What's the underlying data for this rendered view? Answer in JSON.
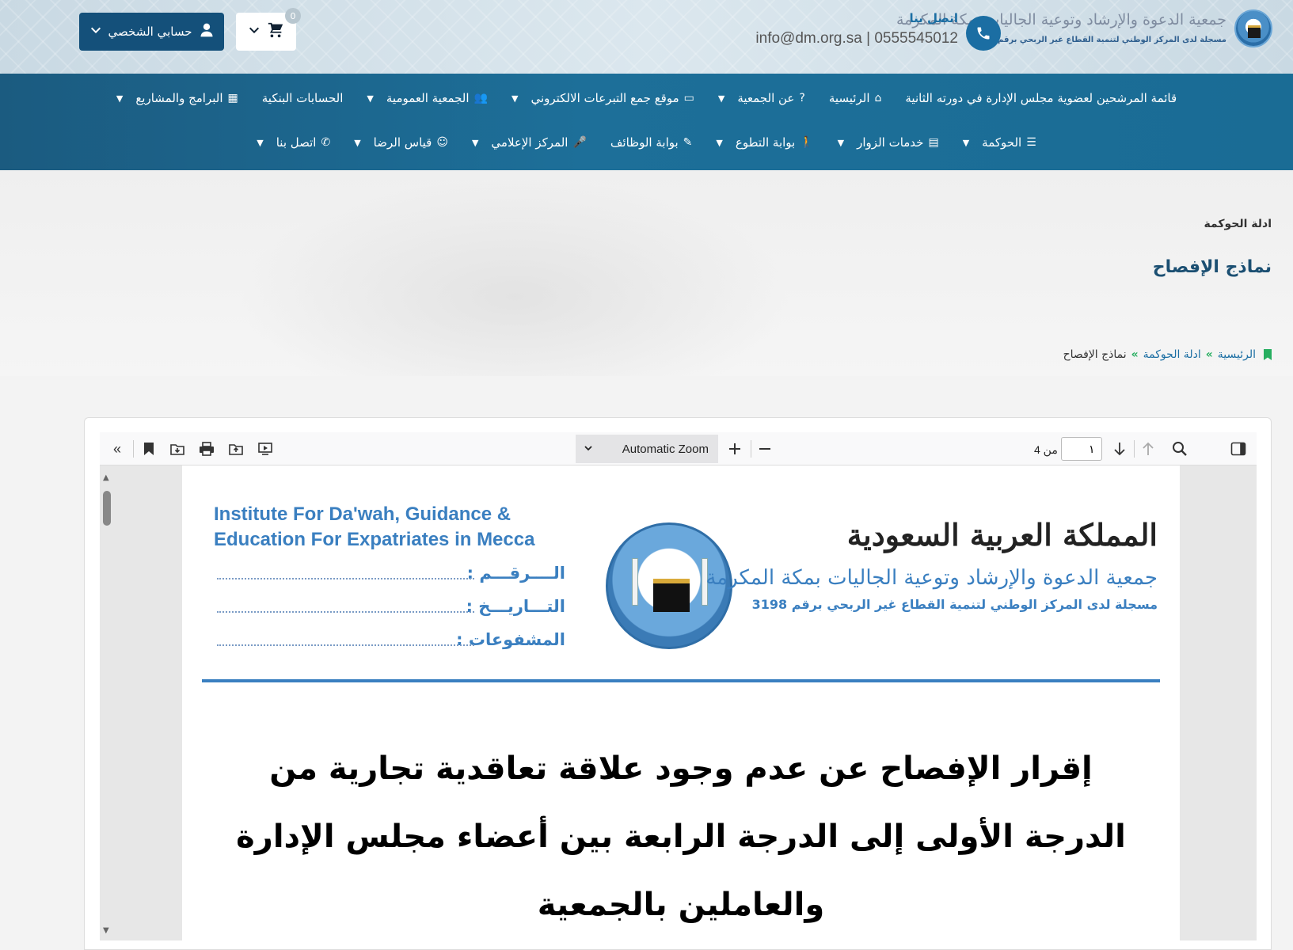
{
  "header": {
    "logo_title": "جمعية الدعوة والإرشاد وتوعية الجاليات بمكة المكرمة",
    "logo_subtitle": "مسجلة لدى المركز الوطني لتنمية القطاع غير الربحي برقم 3198",
    "contact_label": "اتصل بنا",
    "contact_line": "info@dm.org.sa | 0555545012",
    "cart_count": "0",
    "account_label": "حسابي الشخصي"
  },
  "nav": {
    "row1": [
      {
        "label": "قائمة المرشحين لعضوية مجلس الإدارة في دورته الثانية",
        "icon": "",
        "dropdown": false
      },
      {
        "label": "الرئيسية",
        "icon": "home-icon",
        "dropdown": false
      },
      {
        "label": "عن الجمعية",
        "icon": "question-icon",
        "dropdown": true
      },
      {
        "label": "موقع جمع التبرعات الالكتروني",
        "icon": "credit-card-icon",
        "dropdown": true
      },
      {
        "label": "الجمعية العمومية",
        "icon": "users-icon",
        "dropdown": true
      },
      {
        "label": "الحسابات البنكية",
        "icon": "",
        "dropdown": false
      },
      {
        "label": "البرامج والمشاريع",
        "icon": "calendar-icon",
        "dropdown": true
      }
    ],
    "row2": [
      {
        "label": "الحوكمة",
        "icon": "menu-icon",
        "dropdown": true
      },
      {
        "label": "خدمات الزوار",
        "icon": "server-icon",
        "dropdown": true
      },
      {
        "label": "بوابة التطوع",
        "icon": "person-icon",
        "dropdown": true
      },
      {
        "label": "بوابة الوظائف",
        "icon": "edit-icon",
        "dropdown": false
      },
      {
        "label": "المركز الإعلامي",
        "icon": "microphone-icon",
        "dropdown": true
      },
      {
        "label": "قياس الرضا",
        "icon": "smile-icon",
        "dropdown": true
      },
      {
        "label": "اتصل بنا",
        "icon": "phone-icon",
        "dropdown": true
      }
    ]
  },
  "hero": {
    "section": "ادلة الحوكمة",
    "title": "نماذج الإفصاح",
    "breadcrumb": {
      "home": "الرئيسية",
      "parent": "ادلة الحوكمة",
      "current": "نماذج الإفصاح",
      "separator": "»"
    }
  },
  "viewer": {
    "zoom": "Automatic Zoom",
    "page_current": "١",
    "page_total_label": "من 4",
    "pdf": {
      "institute_en": [
        "Institute For Da'wah, Guidance &",
        "Education For Expatriates in Mecca"
      ],
      "ref_labels": [
        "الــــرقـــم :",
        "التـــاريـــخ :",
        "المشفوعات :"
      ],
      "kingdom": "المملكة العربية السعودية",
      "association": "جمعية الدعوة والإرشاد وتوعية الجاليات بمكة المكرمة",
      "registration": "مسجلة لدى المركز الوطني لتنمية القطاع غير الربحي برقم 3198",
      "document_title": "إقرار الإفصاح عن عدم وجود علاقة تعاقدية تجارية من الدرجة الأولى إلى الدرجة الرابعة بين أعضاء مجلس الإدارة والعاملين بالجمعية"
    }
  },
  "colors": {
    "nav": "#1d6f99",
    "primary": "#1b6ea3",
    "account": "#14507a",
    "accent_green": "#27ae60",
    "pdf_blue": "#3a7fc0"
  }
}
